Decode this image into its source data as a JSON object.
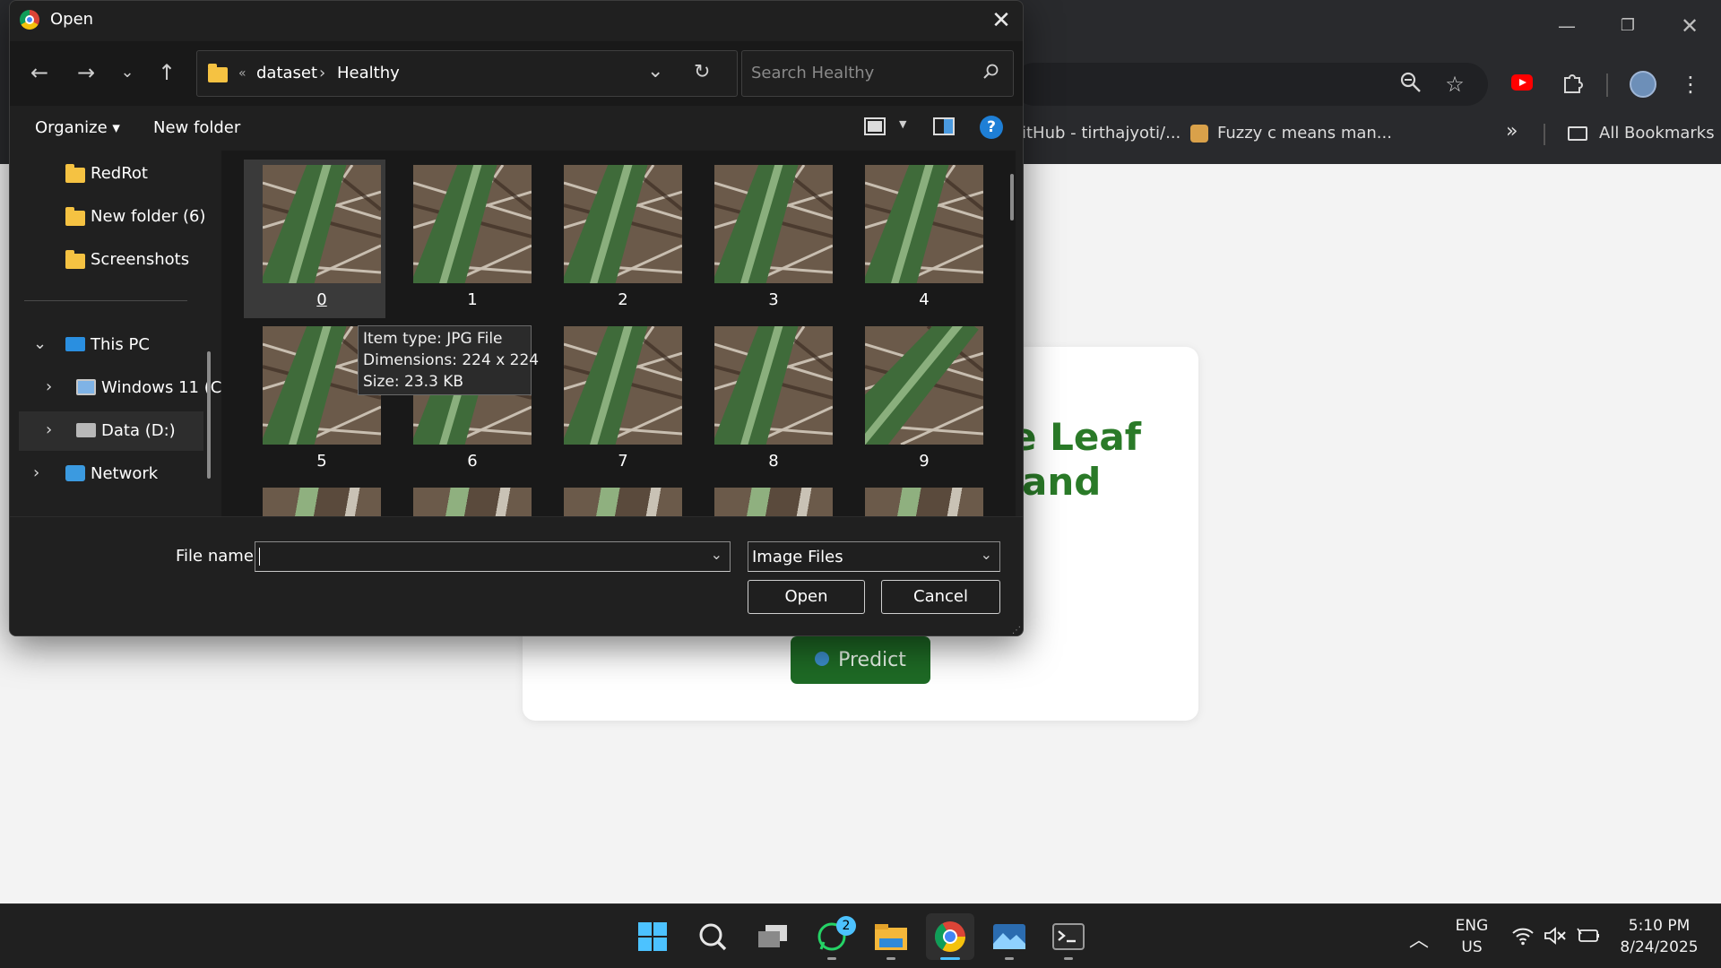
{
  "browser": {
    "bookmarks": [
      {
        "label": "itHub - tirthajyoti/..."
      },
      {
        "label": "Fuzzy c means man..."
      }
    ],
    "all_bookmarks_label": "All Bookmarks",
    "more_bookmarks": "»"
  },
  "page": {
    "title_line1": "e Leaf",
    "title_line2": "and",
    "predict_label": "Predict"
  },
  "dialog": {
    "title": "Open",
    "breadcrumb": {
      "overflow": "«",
      "parent": "dataset",
      "separator": "›",
      "current": "Healthy"
    },
    "search_placeholder": "Search Healthy",
    "organize_label": "Organize",
    "new_folder_label": "New folder",
    "nav_items": [
      {
        "label": "RedRot",
        "icon": "folder-icon"
      },
      {
        "label": "New folder (6)",
        "icon": "folder-icon"
      },
      {
        "label": "Screenshots",
        "icon": "folder-icon"
      },
      {
        "label": "This PC",
        "icon": "pc-icon"
      },
      {
        "label": "Windows 11 (C",
        "icon": "drive-icon"
      },
      {
        "label": "Data (D:)",
        "icon": "drive-icon"
      },
      {
        "label": "Network",
        "icon": "network-icon"
      }
    ],
    "files": [
      "0",
      "1",
      "2",
      "3",
      "4",
      "5",
      "6",
      "7",
      "8",
      "9"
    ],
    "tooltip": {
      "line1": "Item type: JPG File",
      "line2": "Dimensions: 224 x 224",
      "line3": "Size: 23.3 KB"
    },
    "file_name_label": "File name:",
    "file_name_value": "",
    "file_type_value": "Image Files",
    "open_label": "Open",
    "cancel_label": "Cancel"
  },
  "taskbar": {
    "whatsapp_badge": "2",
    "lang_line1": "ENG",
    "lang_line2": "US",
    "time": "5:10 PM",
    "date": "8/24/2025"
  },
  "colors": {
    "accent": "#4cc2ff",
    "leaf_green": "#2a7a28",
    "predict_bg": "#1e6a25"
  }
}
